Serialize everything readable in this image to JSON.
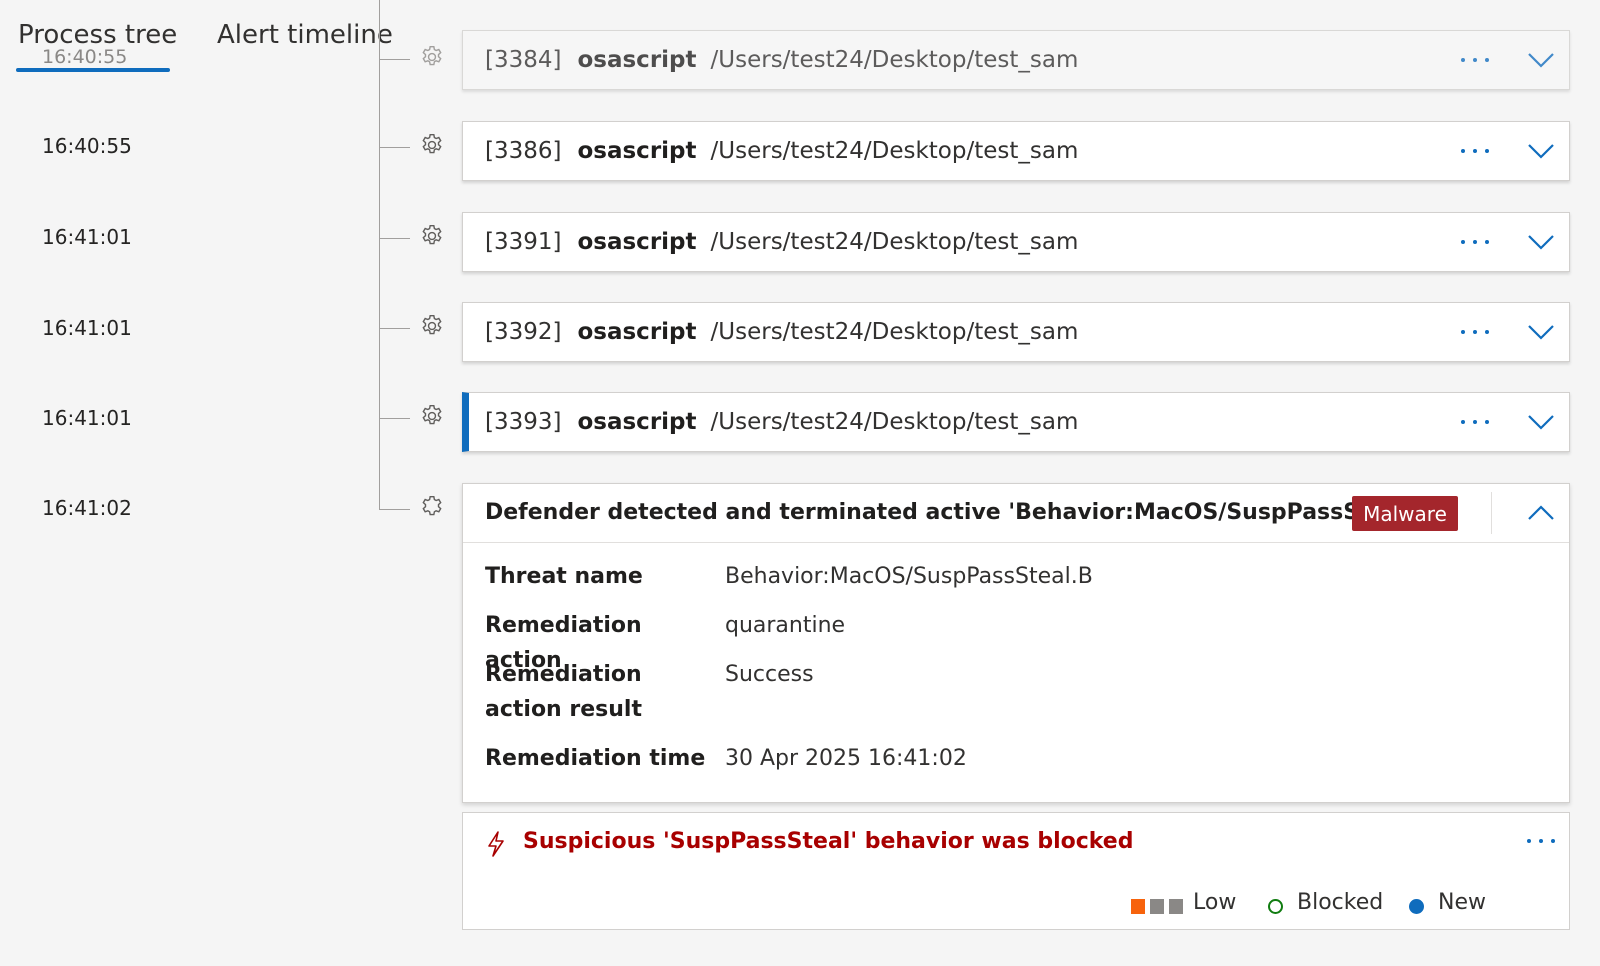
{
  "tabs": {
    "process_tree": "Process tree",
    "alert_timeline": "Alert timeline"
  },
  "ghost_time": "16:40:55",
  "processes": [
    {
      "time": "16:40:55",
      "pid": "[3384]",
      "name": "osascript",
      "path": "/Users/test24/Desktop/test_sam"
    },
    {
      "time": "16:40:55",
      "pid": "[3386]",
      "name": "osascript",
      "path": "/Users/test24/Desktop/test_sam"
    },
    {
      "time": "16:41:01",
      "pid": "[3391]",
      "name": "osascript",
      "path": "/Users/test24/Desktop/test_sam"
    },
    {
      "time": "16:41:01",
      "pid": "[3392]",
      "name": "osascript",
      "path": "/Users/test24/Desktop/test_sam"
    },
    {
      "time": "16:41:01",
      "pid": "[3393]",
      "name": "osascript",
      "path": "/Users/test24/Desktop/test_sam"
    }
  ],
  "detection": {
    "time": "16:41:02",
    "title": "Defender detected and terminated active 'Behavior:MacOS/SuspPassSt...",
    "badge": "Malware",
    "badge_color": "#a4262c",
    "fields": [
      {
        "label": "Threat name",
        "value": "Behavior:MacOS/SuspPassSteal.B"
      },
      {
        "label": "Remediation action",
        "value": "quarantine"
      },
      {
        "label": "Remediation action result",
        "value": "Success"
      },
      {
        "label": "Remediation time",
        "value": "30 Apr 2025 16:41:02"
      }
    ]
  },
  "alert": {
    "title": "Suspicious 'SuspPassSteal' behavior was blocked",
    "title_color": "#a80000",
    "severity": "Low",
    "severity_level": 1,
    "severity_colors": {
      "active": "#f7630c",
      "inactive": "#8a8886"
    },
    "status": "Blocked",
    "status_color": "#107c10",
    "classification": "New",
    "classification_color": "#0f6cbd"
  },
  "colors": {
    "accent": "#0f6cbd"
  },
  "icons": {
    "process": "gear-icon",
    "detection": "puzzle-gear-icon",
    "alert": "lightning-icon",
    "expand": "chevron-down-icon",
    "collapse": "chevron-up-icon",
    "more": "more-actions-icon"
  }
}
